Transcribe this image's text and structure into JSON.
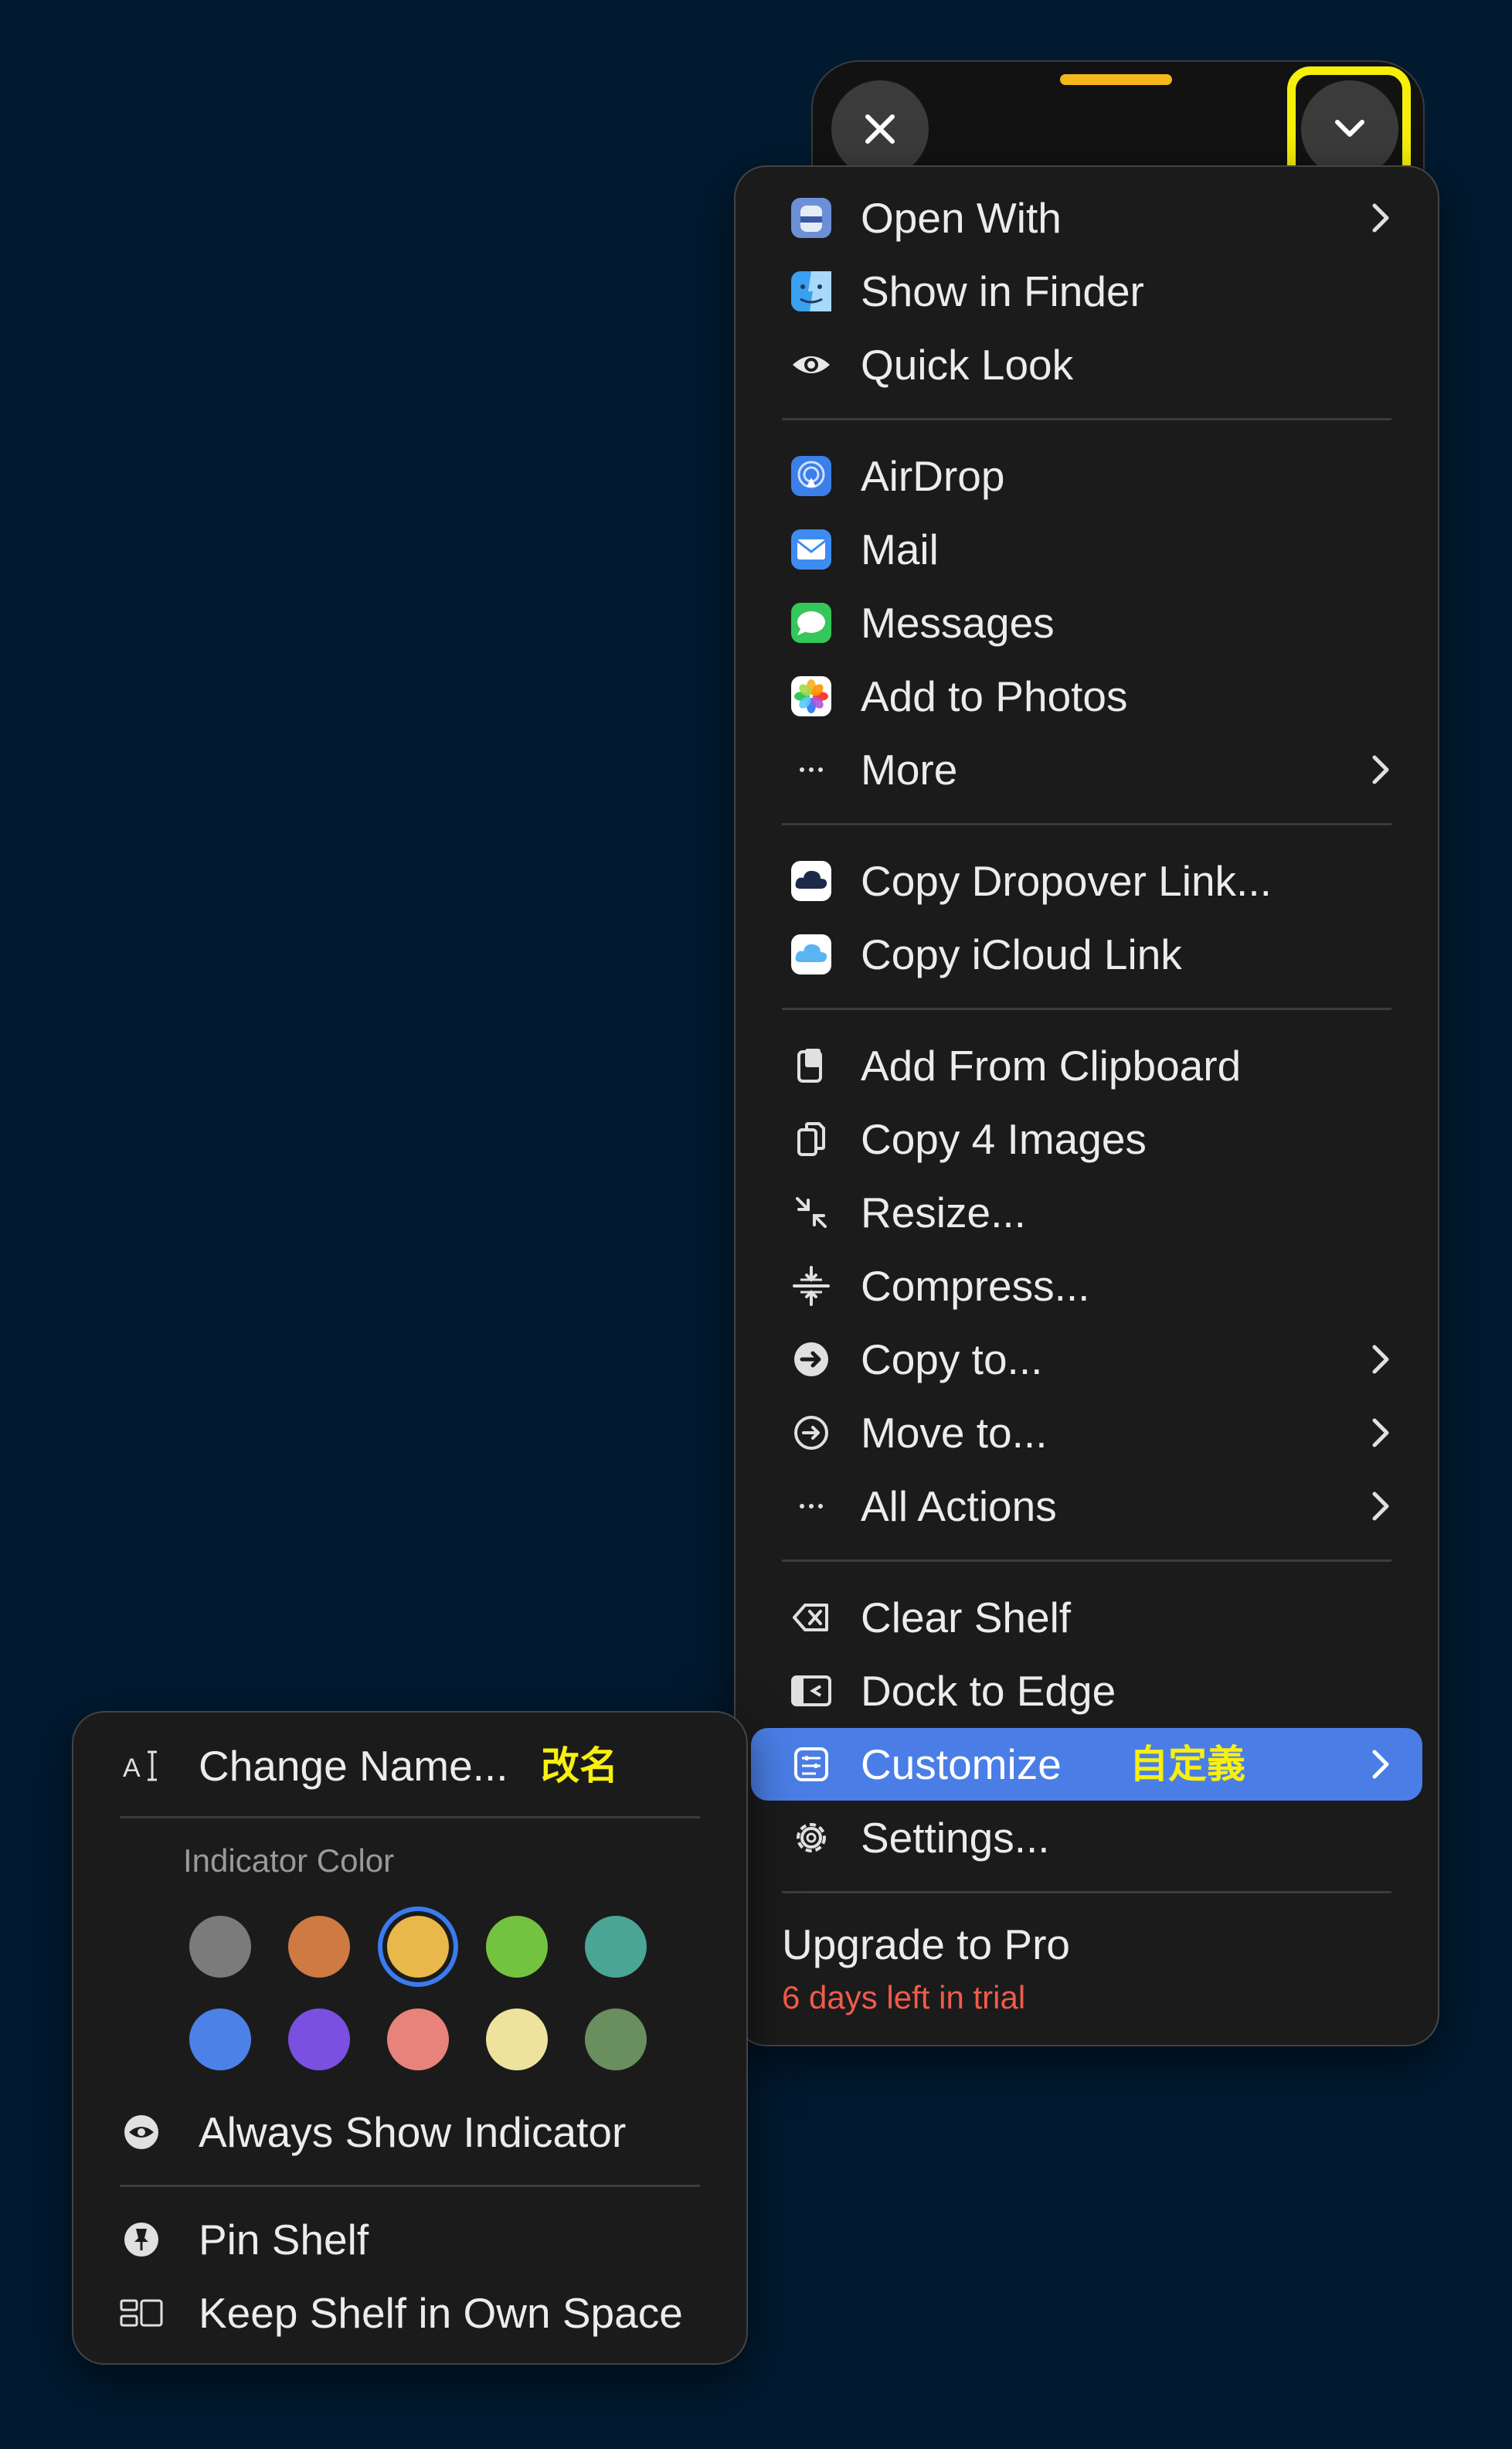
{
  "shelf": {
    "close_icon": "close-icon",
    "collapse_icon": "chevron-down-icon",
    "handle_color": "#f4b81a",
    "highlight_color": "#f6ef0a"
  },
  "main_menu": {
    "open_with": "Open With",
    "show_in_finder": "Show in Finder",
    "quick_look": "Quick Look",
    "airdrop": "AirDrop",
    "mail": "Mail",
    "messages": "Messages",
    "add_to_photos": "Add to Photos",
    "more": "More",
    "copy_dropover_link": "Copy Dropover Link...",
    "copy_icloud_link": "Copy iCloud Link",
    "add_from_clipboard": "Add From Clipboard",
    "copy_images": "Copy 4 Images",
    "resize": "Resize...",
    "compress": "Compress...",
    "copy_to": "Copy to...",
    "move_to": "Move to...",
    "all_actions": "All Actions",
    "clear_shelf": "Clear Shelf",
    "dock_to_edge": "Dock to Edge",
    "customize": "Customize",
    "customize_annotation": "自定義",
    "settings": "Settings...",
    "upgrade": "Upgrade to Pro",
    "trial": "6 days left in trial",
    "selected_color": "#4a7ee6"
  },
  "sub_menu": {
    "change_name": "Change Name...",
    "change_name_annotation": "改名",
    "indicator_color_label": "Indicator Color",
    "colors": [
      "#7b7b7b",
      "#cf7a43",
      "#e8b84a",
      "#74c340",
      "#4aa595",
      "#4c82e7",
      "#7a50e0",
      "#e8837b",
      "#ede39c",
      "#6a8f5e"
    ],
    "selected_color_index": 2,
    "always_show_indicator": "Always Show Indicator",
    "pin_shelf": "Pin Shelf",
    "keep_shelf": "Keep Shelf in Own Space"
  }
}
